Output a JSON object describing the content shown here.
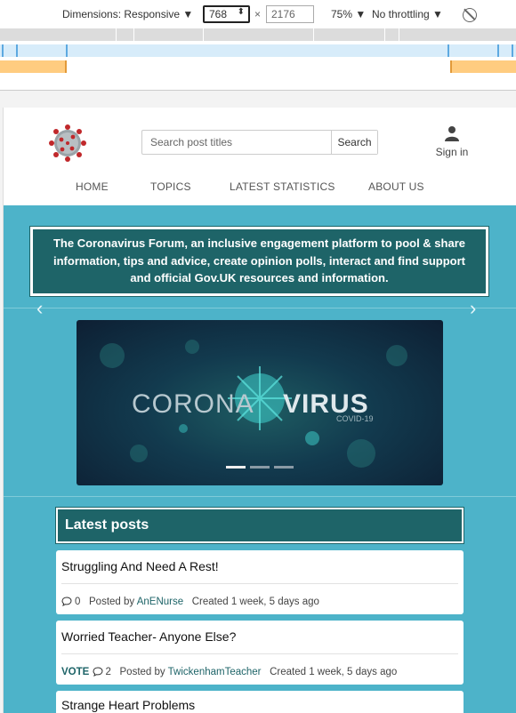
{
  "devtools": {
    "dimensions_label": "Dimensions: Responsive ▼",
    "width_value": "768",
    "times": "×",
    "height_value": "2176",
    "zoom": "75% ▼",
    "throttling": "No throttling ▼"
  },
  "header": {
    "search_placeholder": "Search post titles",
    "search_button": "Search",
    "signin_label": "Sign in"
  },
  "nav": {
    "items": [
      "HOME",
      "TOPICS",
      "LATEST STATISTICS",
      "ABOUT US"
    ]
  },
  "mission": {
    "text": "The Coronavirus Forum, an inclusive engagement platform to pool & share information, tips and advice, create opinion polls, interact and find support and official Gov.UK resources and information."
  },
  "carousel": {
    "word_light": "CORONA",
    "word_bold": "VIRUS",
    "sub": "COVID-19",
    "prev": "‹",
    "next": "›"
  },
  "latest": {
    "heading": "Latest posts",
    "posts": [
      {
        "title": "Struggling And Need A Rest!",
        "vote": "",
        "comments": "0",
        "posted_by": "Posted by",
        "author": "AnENurse",
        "created": "Created 1 week, 5 days ago"
      },
      {
        "title": "Worried Teacher- Anyone Else?",
        "vote": "VOTE",
        "comments": "2",
        "posted_by": "Posted by",
        "author": "TwickenhamTeacher",
        "created": "Created 1 week, 5 days ago"
      },
      {
        "title": "Strange Heart Problems",
        "vote": "",
        "comments": "",
        "posted_by": "",
        "author": "",
        "created": ""
      }
    ]
  },
  "colors": {
    "teal_dark": "#1e6468",
    "teal_band": "#4db3c9"
  }
}
